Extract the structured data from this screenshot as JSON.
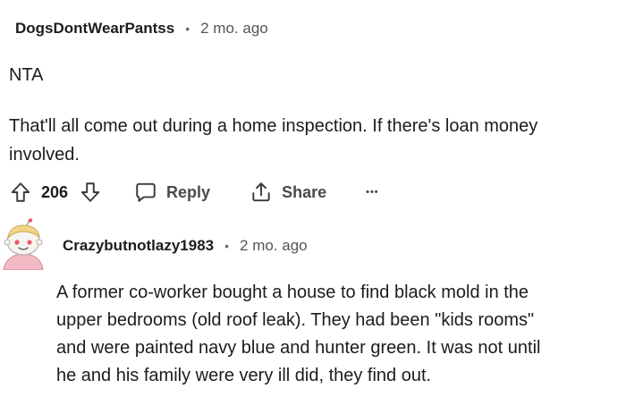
{
  "comment1": {
    "username": "DogsDontWearPantss",
    "separator": "•",
    "timestamp": "2 mo. ago",
    "lines": [
      "NTA",
      "That'll all come out during a home inspection. If there's loan money",
      "involved."
    ],
    "votes": "206",
    "reply_label": "Reply",
    "share_label": "Share",
    "more_label": "•••",
    "icons": {
      "upvote": "arrow-up-icon",
      "downvote": "arrow-down-icon",
      "reply": "speech-bubble-icon",
      "share": "share-icon",
      "more": "more-dots-icon"
    }
  },
  "comment2": {
    "username": "Crazybutnotlazy1983",
    "separator": "•",
    "timestamp": "2 mo. ago",
    "avatar": "snoo-avatar",
    "lines": [
      "A former co-worker bought a house to find black mold in the",
      "upper bedrooms (old roof leak). They had been \"kids rooms\"",
      "and were painted navy blue and hunter green. It was not until",
      "he and his family were very ill did, they find out."
    ]
  },
  "colors": {
    "text": "#1c1c1c",
    "muted": "#555555",
    "icon": "#3b3b3b",
    "avatar_accent": "#e8556b"
  }
}
